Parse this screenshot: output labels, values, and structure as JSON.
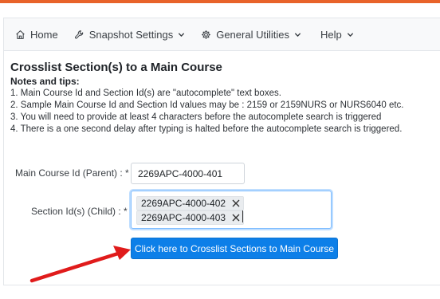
{
  "nav": {
    "home": "Home",
    "snapshot": "Snapshot Settings",
    "general": "General Utilities",
    "help": "Help"
  },
  "page": {
    "title": "Crosslist Section(s) to a Main Course",
    "notes_title": "Notes and tips:",
    "notes": [
      "1. Main Course Id and Section Id(s) are \"autocomplete\" text boxes.",
      "2. Sample Main Course Id and Section Id values may be : 2159 or 2159NURS or NURS6040 etc.",
      "3. You will need to provide at least 4 characters before the autocomplete search is triggered",
      "4. There is a one second delay after typing is halted before the autocomplete search is triggered."
    ]
  },
  "form": {
    "main_label": "Main Course Id (Parent) :  *",
    "main_value": "2269APC-4000-401",
    "section_label": "Section Id(s) (Child) :  *",
    "sections": [
      "2269APC-4000-402",
      "2269APC-4000-403"
    ],
    "submit": "Click here to Crosslist Sections to Main Course"
  },
  "colors": {
    "accent": "#e8632a",
    "primary": "#0d7fe8",
    "annotation_arrow": "#e01b1b"
  }
}
